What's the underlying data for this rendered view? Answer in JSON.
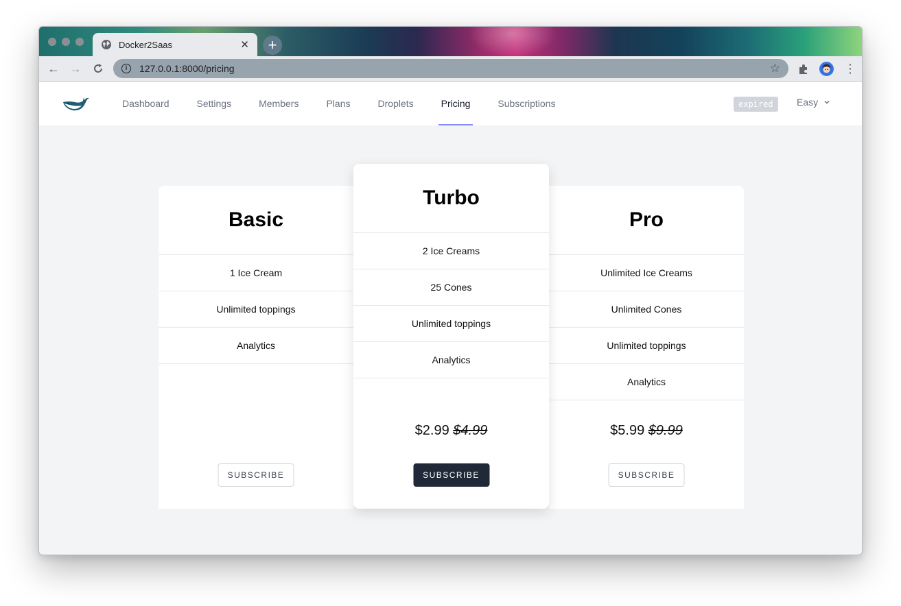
{
  "browser": {
    "tab_title": "Docker2Saas",
    "url": "127.0.0.1:8000/pricing",
    "new_tab_symbol": "+",
    "close_symbol": "✕"
  },
  "nav": {
    "links": [
      "Dashboard",
      "Settings",
      "Members",
      "Plans",
      "Droplets",
      "Pricing",
      "Subscriptions"
    ],
    "active": "Pricing",
    "status_badge": "expired",
    "user": "Easy"
  },
  "plans": [
    {
      "name": "Basic",
      "features": [
        "1 Ice Cream",
        "Unlimited toppings",
        "Analytics"
      ],
      "price": "",
      "old_price": "",
      "button": "SUBSCRIBE"
    },
    {
      "name": "Turbo",
      "features": [
        "2 Ice Creams",
        "25 Cones",
        "Unlimited toppings",
        "Analytics"
      ],
      "price": "$2.99",
      "old_price": "$4.99",
      "button": "SUBSCRIBE"
    },
    {
      "name": "Pro",
      "features": [
        "Unlimited Ice Creams",
        "Unlimited Cones",
        "Unlimited toppings",
        "Analytics"
      ],
      "price": "$5.99",
      "old_price": "$9.99",
      "button": "SUBSCRIBE"
    }
  ],
  "colors": {
    "active_underline": "#818cf8",
    "primary_button": "#1f2937",
    "page_background": "#f3f4f6"
  }
}
